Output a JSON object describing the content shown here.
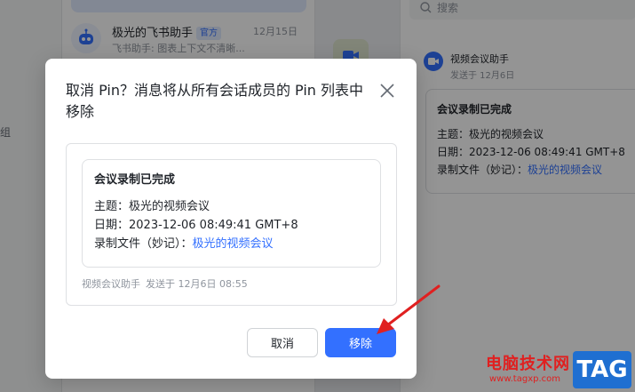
{
  "background": {
    "side_text": "组",
    "chat": {
      "name": "极光的飞书助手",
      "badge": "官方",
      "date": "12月15日",
      "preview": "飞书助手: 图表上下文不清晰..."
    },
    "search_placeholder": "搜索",
    "pin": {
      "sender": "视频会议助手",
      "sent_at": "发送于 12月6日",
      "card": {
        "title": "会议录制已完成",
        "topic": "主题：极光的视频会议",
        "date": "日期：2023-12-06 08:49:41 GMT+8",
        "file_label": "录制文件（妙记）：",
        "file_link": "极光的视频会议"
      }
    }
  },
  "dialog": {
    "title": "取消 Pin？消息将从所有会话成员的 Pin 列表中移除",
    "close_icon": "close-icon",
    "card": {
      "title": "会议录制已完成",
      "topic": "主题：极光的视频会议",
      "date": "日期：2023-12-06 08:49:41 GMT+8",
      "file_label": "录制文件（妙记）：",
      "file_link": "极光的视频会议"
    },
    "footer_sender": "视频会议助手",
    "footer_time": "发送于 12月6日 08:55",
    "cancel_label": "取消",
    "remove_label": "移除"
  },
  "colors": {
    "primary": "#3370ff",
    "overlay": "rgba(0,0,0,0.42)",
    "annotation": "#e02020"
  },
  "watermark": {
    "site_name": "电脑技术网",
    "url": "www.tagxp.com",
    "tag": "TAG"
  }
}
